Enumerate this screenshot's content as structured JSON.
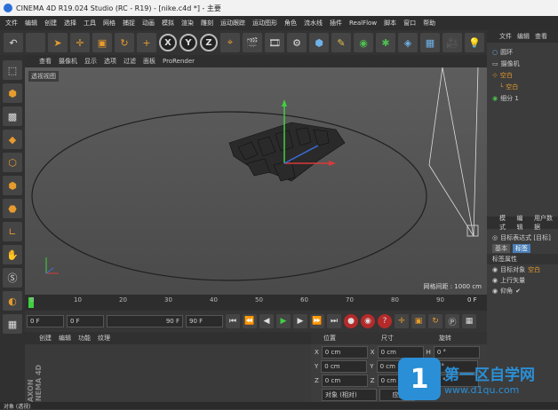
{
  "window": {
    "title": "CINEMA 4D R19.024 Studio (RC - R19) - [nike.c4d *] - 主要"
  },
  "menu": [
    "文件",
    "编辑",
    "创建",
    "选择",
    "工具",
    "网格",
    "捕捉",
    "动画",
    "模拟",
    "渲染",
    "雕刻",
    "运动跟踪",
    "运动图形",
    "角色",
    "流水线",
    "插件",
    "RealFlow",
    "脚本",
    "窗口",
    "帮助"
  ],
  "toolbar": {
    "undo": "↶",
    "axes": [
      "X",
      "Y",
      "Z"
    ]
  },
  "viewport": {
    "menu": [
      "查看",
      "摄像机",
      "显示",
      "选项",
      "过滤",
      "面板",
      "ProRender"
    ],
    "view_label": "透视视图",
    "grid_spacing": "网格间距 : 1000 cm"
  },
  "timeline": {
    "ticks": [
      "0",
      "10",
      "20",
      "30",
      "40",
      "50",
      "60",
      "70",
      "80",
      "90"
    ],
    "end_frame": "0 F"
  },
  "transport": {
    "current": "0 F",
    "start": "0 F",
    "end_preview": "90 F",
    "end": "90 F"
  },
  "material": {
    "tabs": [
      "创建",
      "编辑",
      "功能",
      "纹理"
    ]
  },
  "coords": {
    "headers": [
      "位置",
      "尺寸",
      "旋转"
    ],
    "rows": [
      {
        "axis": "X",
        "pos": "0 cm",
        "size_axis": "X",
        "size": "0 cm",
        "rot_axis": "H",
        "rot": "0 °"
      },
      {
        "axis": "Y",
        "pos": "0 cm",
        "size_axis": "Y",
        "size": "0 cm",
        "rot_axis": "P",
        "rot": "0 °"
      },
      {
        "axis": "Z",
        "pos": "0 cm",
        "size_axis": "Z",
        "size": "0 cm",
        "rot_axis": "B",
        "rot": "0 °"
      }
    ],
    "mode": "对象 (相对)",
    "apply": "应用"
  },
  "objects": {
    "tabs": [
      "文件",
      "编辑",
      "查看"
    ],
    "items": [
      "圆环",
      "摄像机",
      "空白",
      "空白",
      "细分 1"
    ]
  },
  "attributes": {
    "tabs": [
      "模式",
      "编辑",
      "用户数据"
    ],
    "title": "目标表达式 [目标]",
    "subtabs": [
      "基本",
      "标签"
    ],
    "section": "标签属性",
    "fields": [
      "目标对象",
      "上行矢量",
      "仰角"
    ],
    "target_value": "空白"
  },
  "status": "对象 (透视)",
  "watermark": {
    "brand": "第一区自学网",
    "url": "www.d1qu.com"
  },
  "colors": {
    "accent": "#e69b2d",
    "x_axis": "#d93a3a",
    "y_axis": "#3fd03f",
    "z_axis": "#3a6fd9",
    "brand": "#2a8fd6"
  }
}
